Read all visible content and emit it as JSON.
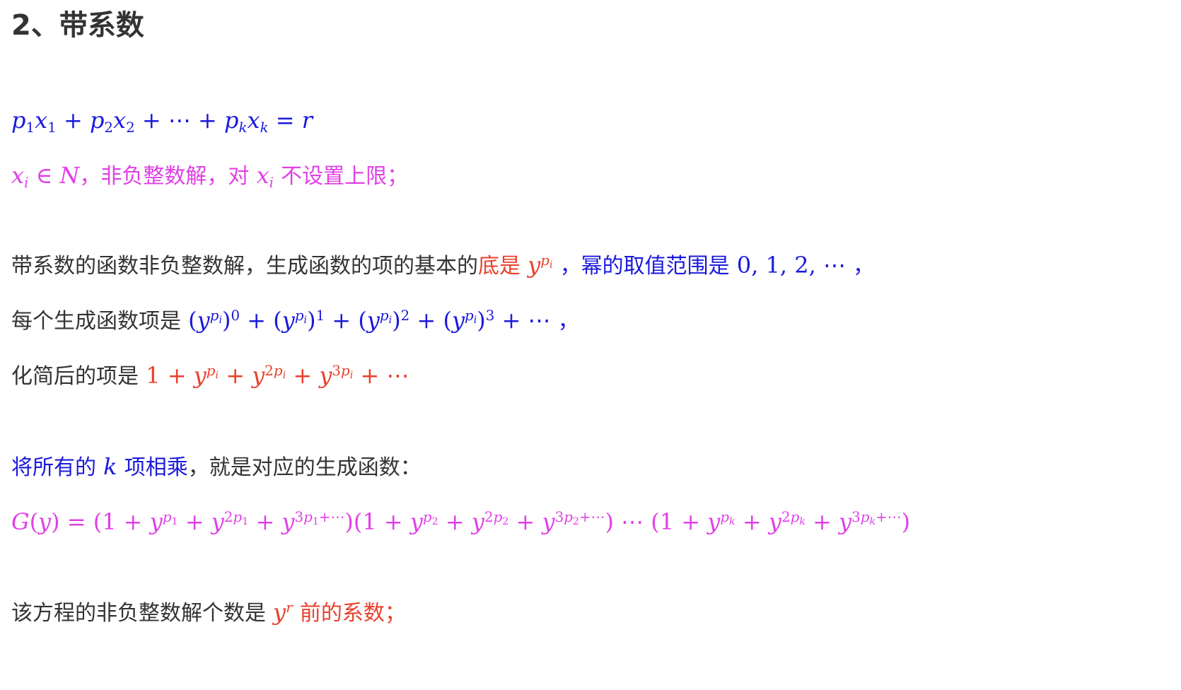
{
  "heading": "2、带系数",
  "l2": {
    "text_1": "，非负整数解，对",
    "text_2": "不设置上限；"
  },
  "l3": {
    "text_1": "带系数的函数非负整数解，生成函数的项的基本的",
    "text_2": "底是",
    "text_3": "，幂的取值范围是",
    "text_4": "，"
  },
  "l4": {
    "text_1": "每个生成函数项是",
    "text_2": "，"
  },
  "l5": {
    "text_1": "化简后的项是"
  },
  "l6": {
    "text_1": "将所有的",
    "text_2": "项相乘",
    "text_3": "，就是对应的生成函数："
  },
  "l8": {
    "text_1": "该方程的非负整数解个数是",
    "text_2": "前的系数；"
  },
  "colors": {
    "blue": "#1a1adc",
    "magenta": "#e040e6",
    "red": "#e8412c",
    "gray_text": "#333333"
  }
}
